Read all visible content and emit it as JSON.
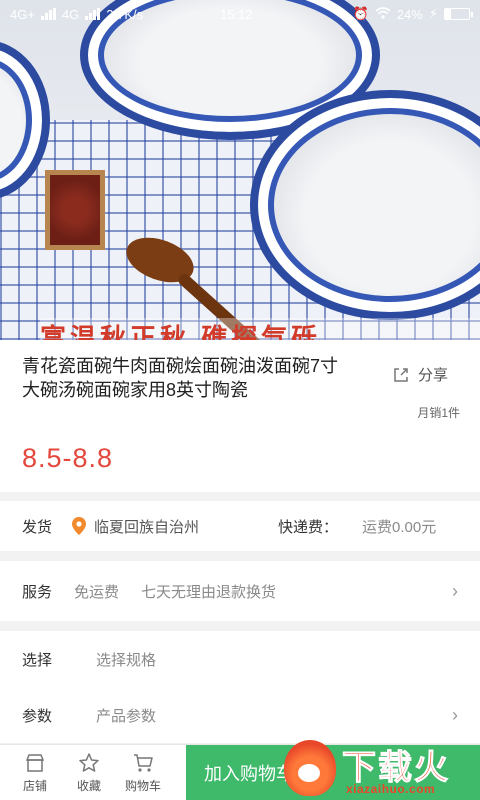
{
  "status_bar": {
    "network_1": "4G+",
    "network_2": "4G",
    "speed": "2.7K/s",
    "time": "15:12",
    "battery": "24%",
    "battery_level": 0.24
  },
  "hero": {
    "banner_text": "富温秋正秋 礁探气砾"
  },
  "product": {
    "title": "青花瓷面碗牛肉面碗烩面碗油泼面碗7寸大碗汤碗面碗家用8英寸陶瓷",
    "share_label": "分享",
    "sales": "月销1件",
    "price": "8.5-8.8"
  },
  "shipping": {
    "label": "发货",
    "location": "临夏回族自治州",
    "fee_label": "快递费：",
    "fee_value": "运费0.00元"
  },
  "service": {
    "label": "服务",
    "item_1": "免运费",
    "item_2": "七天无理由退款换货"
  },
  "select": {
    "label": "选择",
    "value": "选择规格"
  },
  "params": {
    "label": "参数",
    "value": "产品参数"
  },
  "bottom_bar": {
    "store": "店铺",
    "favorite": "收藏",
    "cart": "购物车",
    "add_to_cart": "加入购物车"
  },
  "watermark": {
    "brand": "下载火",
    "url": "xiazaihuo.com"
  },
  "colors": {
    "price": "#e4473b",
    "cart_button": "#3fba6b",
    "pin": "#f08a2c",
    "watermark": "#e8472a"
  }
}
